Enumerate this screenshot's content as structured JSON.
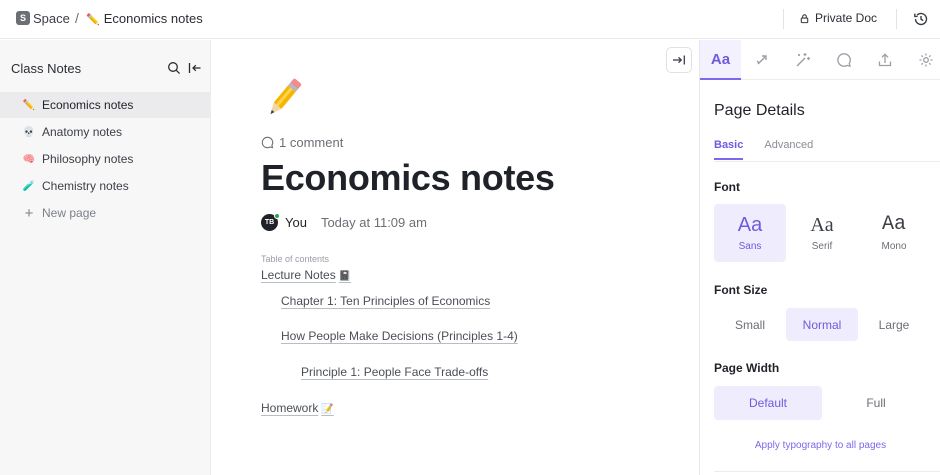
{
  "topbar": {
    "space_badge": "S",
    "space": "Space",
    "separator": "/",
    "doc_emoji": "✏️",
    "doc_title": "Economics notes",
    "private_doc": "Private Doc",
    "icons": [
      "lock-icon",
      "history-icon"
    ]
  },
  "sidebar": {
    "title": "Class Notes",
    "icons": [
      "search-icon",
      "collapse-sidebar-icon"
    ],
    "items": [
      {
        "emoji": "✏️",
        "label": "Economics notes",
        "active": true
      },
      {
        "emoji": "💀",
        "label": "Anatomy notes",
        "active": false
      },
      {
        "emoji": "🧠",
        "label": "Philosophy notes",
        "active": false
      },
      {
        "emoji": "🧪",
        "label": "Chemistry notes",
        "active": false
      }
    ],
    "new_page": "New page"
  },
  "doc": {
    "icon": "pencil-icon",
    "comment_count": "1 comment",
    "title": "Economics notes",
    "author_initials": "TB",
    "author_name": "You",
    "timestamp": "Today at 11:09 am",
    "toc_label": "Table of contents",
    "toc": [
      {
        "label": "Lecture Notes",
        "emoji": "📓"
      },
      {
        "label": "Chapter 1: Ten Principles of Economics"
      },
      {
        "label": "How People Make Decisions (Principles 1-4)"
      },
      {
        "label": "Principle 1: People Face Trade-offs"
      },
      {
        "label": "Homework",
        "emoji": "📝"
      }
    ]
  },
  "panel": {
    "tabs": [
      {
        "icon": "typography-icon",
        "label": "Aa",
        "active": true
      },
      {
        "icon": "relationships-icon"
      },
      {
        "icon": "magic-wand-icon"
      },
      {
        "icon": "comment-icon"
      },
      {
        "icon": "export-icon"
      },
      {
        "icon": "settings-icon"
      }
    ],
    "title": "Page Details",
    "subtabs": [
      "Basic",
      "Advanced"
    ],
    "font_label": "Font",
    "fonts": [
      {
        "sample": "Aa",
        "name": "Sans",
        "selected": true
      },
      {
        "sample": "Aa",
        "name": "Serif",
        "selected": false
      },
      {
        "sample": "Aa",
        "name": "Mono",
        "selected": false
      }
    ],
    "font_size_label": "Font Size",
    "sizes": [
      {
        "label": "Small",
        "selected": false
      },
      {
        "label": "Normal",
        "selected": true
      },
      {
        "label": "Large",
        "selected": false
      }
    ],
    "page_width_label": "Page Width",
    "widths": [
      {
        "label": "Default",
        "selected": true
      },
      {
        "label": "Full",
        "selected": false
      }
    ],
    "apply_link": "Apply typography to all pages"
  },
  "colors": {
    "accent": "#7b68ee",
    "accent_text": "#6f5bdd",
    "accent_bg": "#efecfd",
    "sidebar_bg": "#f7f7f8"
  }
}
